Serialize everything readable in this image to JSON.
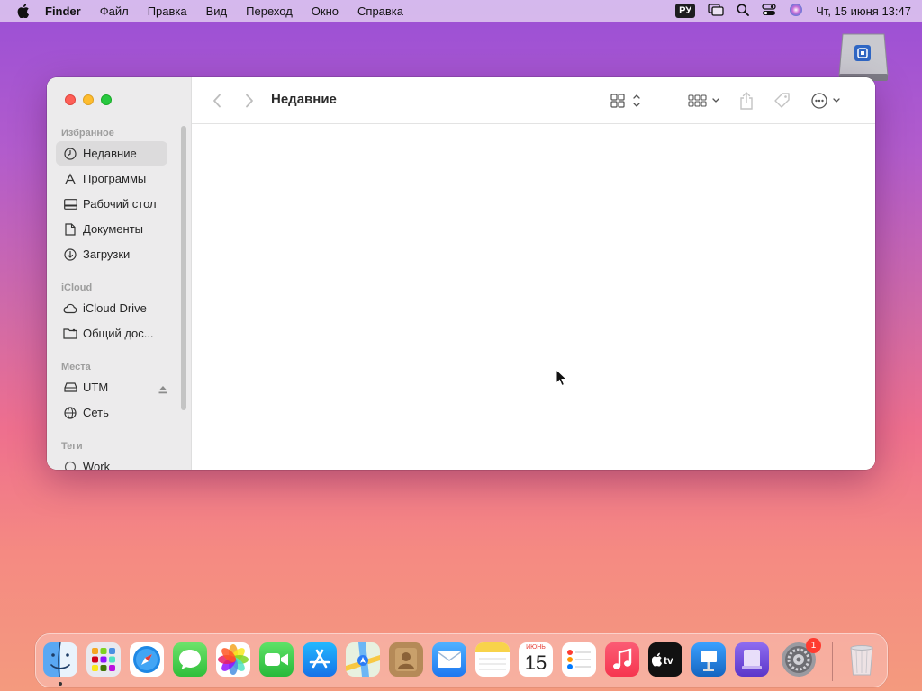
{
  "menubar": {
    "app_name": "Finder",
    "items": [
      "Файл",
      "Правка",
      "Вид",
      "Переход",
      "Окно",
      "Справка"
    ],
    "keyboard_layout": "РУ",
    "clock": "Чт, 15 июня  13:47"
  },
  "window": {
    "title": "Недавние",
    "sidebar": {
      "sections": {
        "favorites": "Избранное",
        "icloud": "iCloud",
        "locations": "Места",
        "tags": "Теги"
      },
      "favorites": [
        {
          "label": "Недавние",
          "icon": "clock-icon",
          "selected": true
        },
        {
          "label": "Программы",
          "icon": "apps-icon"
        },
        {
          "label": "Рабочий стол",
          "icon": "desktop-icon"
        },
        {
          "label": "Документы",
          "icon": "document-icon"
        },
        {
          "label": "Загрузки",
          "icon": "download-icon"
        }
      ],
      "icloud": [
        {
          "label": "iCloud Drive",
          "icon": "cloud-icon"
        },
        {
          "label": "Общий дос...",
          "icon": "shared-folder-icon"
        }
      ],
      "locations": [
        {
          "label": "UTM",
          "icon": "drive-icon"
        },
        {
          "label": "Сеть",
          "icon": "globe-icon"
        }
      ],
      "tags": [
        {
          "label": "Work",
          "icon": "tag-icon"
        }
      ]
    }
  },
  "dock": {
    "apps": [
      "Finder",
      "Launchpad",
      "Safari",
      "Сообщения",
      "Фото",
      "FaceTime",
      "App Store",
      "Карты",
      "Контакты",
      "Почта",
      "Заметки",
      "Календарь",
      "Напоминания",
      "Музыка",
      "TV",
      "Keynote",
      "Simulator",
      "Системные настройки",
      "Корзина"
    ],
    "calendar_month": "ИЮНЬ",
    "calendar_day": "15",
    "settings_badge": "1",
    "tv_label": "tv"
  },
  "colors": {
    "accent_red": "#fe5f57",
    "accent_yellow": "#febc2e",
    "accent_green": "#28c840"
  }
}
